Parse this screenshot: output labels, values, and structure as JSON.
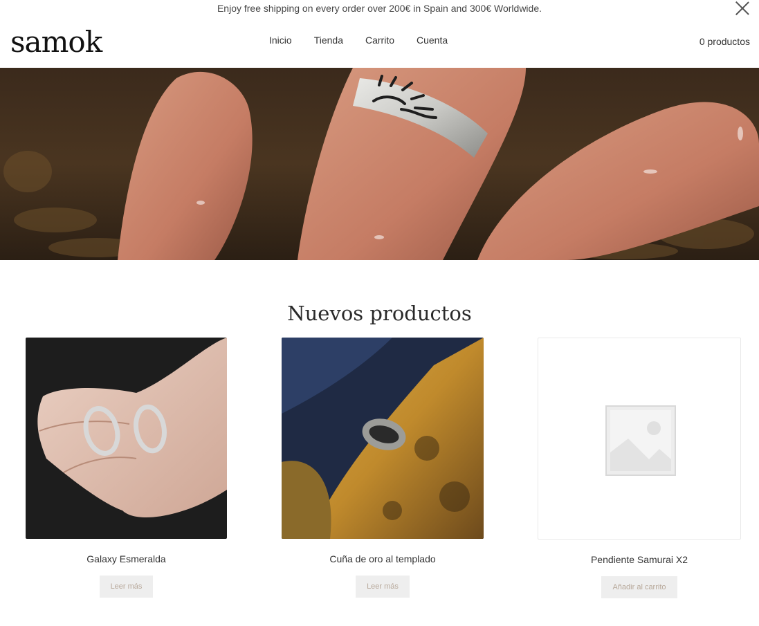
{
  "announcement": {
    "text": "Enjoy free shipping on every order over 200€ in Spain and 300€ Worldwide."
  },
  "header": {
    "logo": "samok",
    "nav": [
      "Inicio",
      "Tienda",
      "Carrito",
      "Cuenta"
    ],
    "cart_label": "0 productos"
  },
  "main": {
    "section_title": "Nuevos productos",
    "products": [
      {
        "name": "Galaxy Esmeralda",
        "button": "Leer más"
      },
      {
        "name": "Cuña de oro al templado",
        "button": "Leer más"
      },
      {
        "name": "Pendiente Samurai X2",
        "button": "Añadir al carrito"
      }
    ]
  },
  "colors": {
    "background": "#ffffff",
    "text": "#333333",
    "button_bg": "#eeeeee",
    "button_text": "#b7a89a"
  }
}
